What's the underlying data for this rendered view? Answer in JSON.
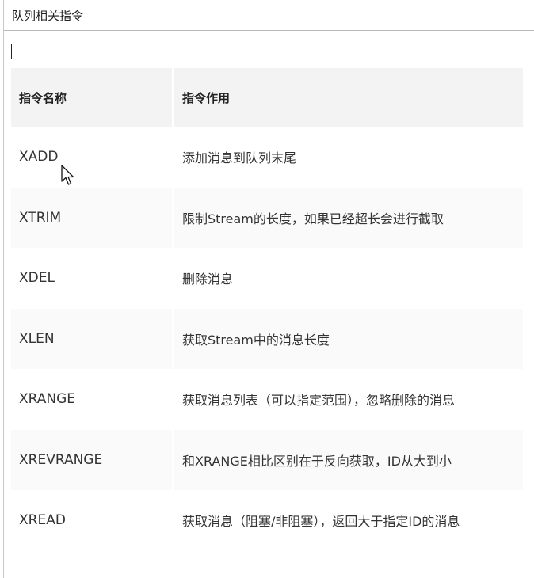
{
  "heading": "队列相关指令",
  "table": {
    "headers": {
      "name": "指令名称",
      "desc": "指令作用"
    },
    "rows": [
      {
        "name": "XADD",
        "desc": "添加消息到队列末尾"
      },
      {
        "name": "XTRIM",
        "desc": "限制Stream的长度，如果已经超长会进行截取"
      },
      {
        "name": "XDEL",
        "desc": "删除消息"
      },
      {
        "name": "XLEN",
        "desc": "获取Stream中的消息长度"
      },
      {
        "name": "XRANGE",
        "desc": "获取消息列表（可以指定范围），忽略删除的消息"
      },
      {
        "name": "XREVRANGE",
        "desc": "和XRANGE相比区别在于反向获取，ID从大到小"
      },
      {
        "name": "XREAD",
        "desc": "获取消息（阻塞/非阻塞），返回大于指定ID的消息"
      }
    ]
  },
  "icons": {
    "pointer": "mouse-pointer-icon"
  }
}
